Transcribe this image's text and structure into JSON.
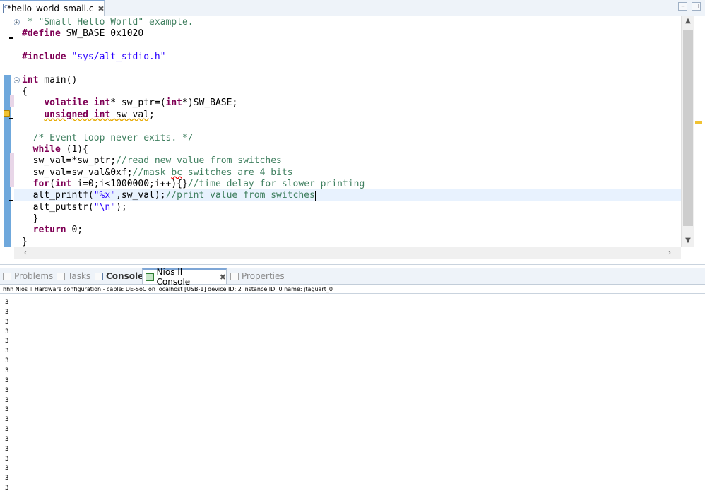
{
  "editor": {
    "tab_title": "*hello_world_small.c",
    "tab_close": "✖",
    "minimize": "–",
    "maximize": "□"
  },
  "code_lines": [
    " * \"Small Hello World\" example.",
    "#define SW_BASE 0x1020",
    "",
    "#include \"sys/alt_stdio.h\"",
    "",
    "int main()",
    "{",
    "    volatile int* sw_ptr=(int*)SW_BASE;",
    "    unsigned int sw_val;",
    "",
    "  /* Event loop never exits. */",
    "  while (1){",
    "  sw_val=*sw_ptr;//read new value from switches",
    "  sw_val=sw_val&0xf;//mask bc switches are 4 bits",
    "  for(int i=0;i<1000000;i++){}//time delay for slower printing",
    "  alt_printf(\"%x\",sw_val);//print value from switches",
    "  alt_putstr(\"\\n\");",
    "  }",
    "  return 0;",
    "}"
  ],
  "views": {
    "tabs": [
      {
        "label": "Problems"
      },
      {
        "label": "Tasks"
      },
      {
        "label": "Console"
      },
      {
        "label": "Nios II Console"
      },
      {
        "label": "Properties"
      }
    ],
    "close": "✖"
  },
  "console": {
    "header": "hhh Nios II Hardware configuration - cable: DE-SoC on localhost [USB-1] device ID: 2 instance ID: 0 name: jtaguart_0",
    "lines": [
      "3",
      "3",
      "3",
      "3",
      "3",
      "3",
      "3",
      "3",
      "3",
      "3",
      "3",
      "3",
      "3",
      "3",
      "3",
      "3",
      "3",
      "3",
      "3",
      "3"
    ]
  },
  "colors": {
    "keyword": "#7f0055",
    "string": "#2a00ff",
    "comment": "#3f7f5f",
    "current_line": "#e8f2fe",
    "quick_diff": "#6fa8dc"
  }
}
